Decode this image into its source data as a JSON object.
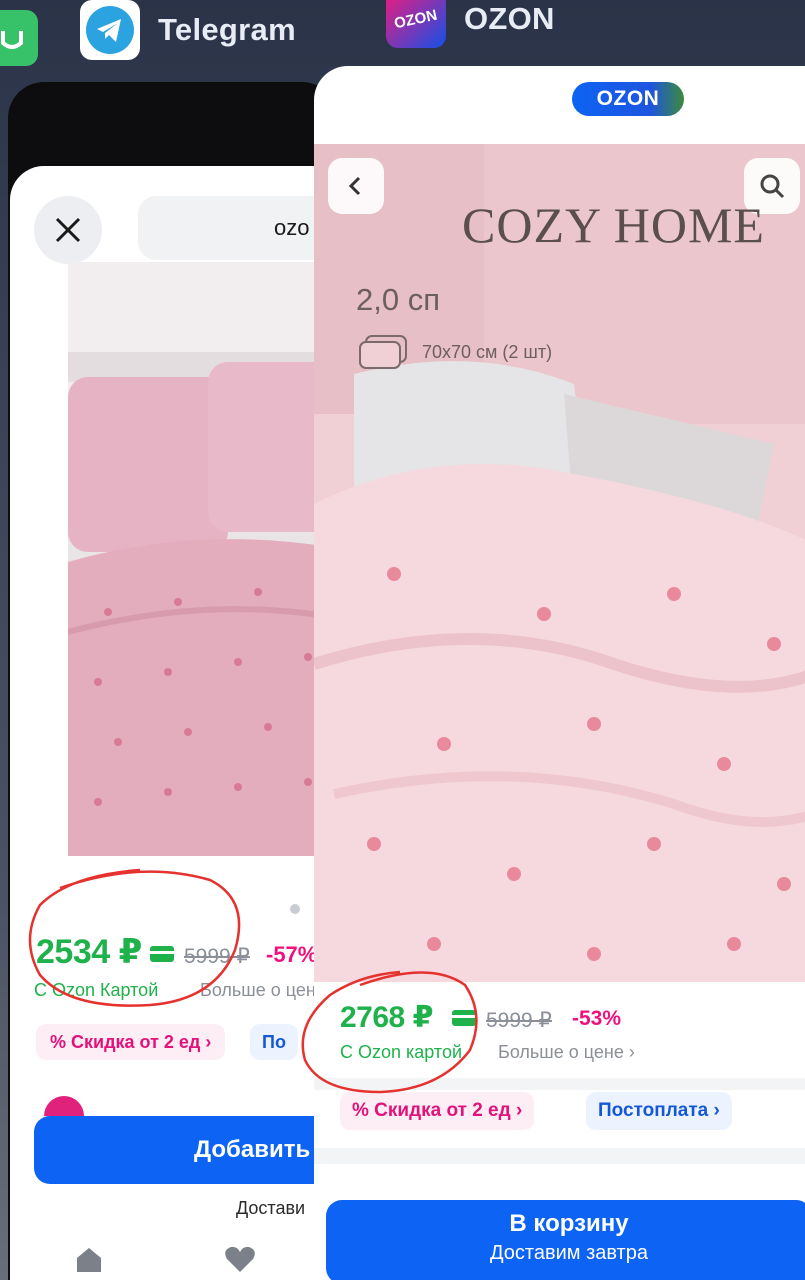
{
  "switcher": {
    "apps": [
      {
        "label": "Telegram",
        "icon": "telegram-icon"
      },
      {
        "label": "OZON",
        "icon": "ozon-app-icon",
        "icon_text": "OZON"
      }
    ]
  },
  "left_card": {
    "address_text": "ozo",
    "price": "2534 ₽",
    "old_price": "5999 ₽",
    "discount": "-57%",
    "ozon_card_label": "С Ozon Картой",
    "more_price_label": "Больше о цене",
    "tag_discount": "% Скидка от 2 ед ›",
    "tag_postpay": "По",
    "add_button_label": "Добавить",
    "delivery_text": "Достави"
  },
  "right_card": {
    "header_logo": "OZON",
    "brand_overlay": "COZY HOME",
    "size_label": "2,0 сп",
    "pillow_label": "70x70 см (2 шт)",
    "price": "2768 ₽",
    "old_price": "5999 ₽",
    "discount": "-53%",
    "ozon_card_label": "С Ozon картой",
    "more_price_label": "Больше о цене ›",
    "tag_discount": "% Скидка от 2 ед ›",
    "tag_postpay": "Постоплата ›",
    "cart_button_label": "В корзину",
    "cart_button_sub": "Доставим завтра"
  },
  "colors": {
    "price_green": "#1fb24b",
    "discount_pink": "#f1117e",
    "ozon_blue": "#0d63f3",
    "annotation_red": "#e5322f"
  }
}
